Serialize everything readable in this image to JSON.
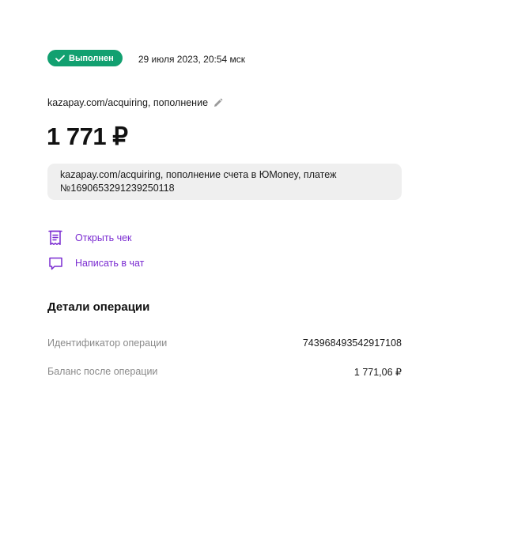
{
  "status": {
    "badge_label": "Выполнен",
    "badge_color": "#12a070",
    "date": "29 июля 2023, 20:54 мск"
  },
  "merchant": {
    "title": "kazapay.com/acquiring, пополнение",
    "edit_icon": "pencil-icon"
  },
  "amount": "1 771 ₽",
  "comment": "kazapay.com/acquiring, пополнение счета в ЮMoney, платеж №1690653291239250118",
  "actions": [
    {
      "label": "Открыть чек",
      "icon": "receipt-icon"
    },
    {
      "label": "Написать в чат",
      "icon": "chat-icon"
    }
  ],
  "accent_color": "#7a2bd1",
  "details": {
    "title": "Детали операции",
    "rows": [
      {
        "label": "Идентификатор операции",
        "value": "743968493542917108"
      },
      {
        "label": "Баланс после операции",
        "value": "1 771,06 ₽"
      }
    ]
  }
}
